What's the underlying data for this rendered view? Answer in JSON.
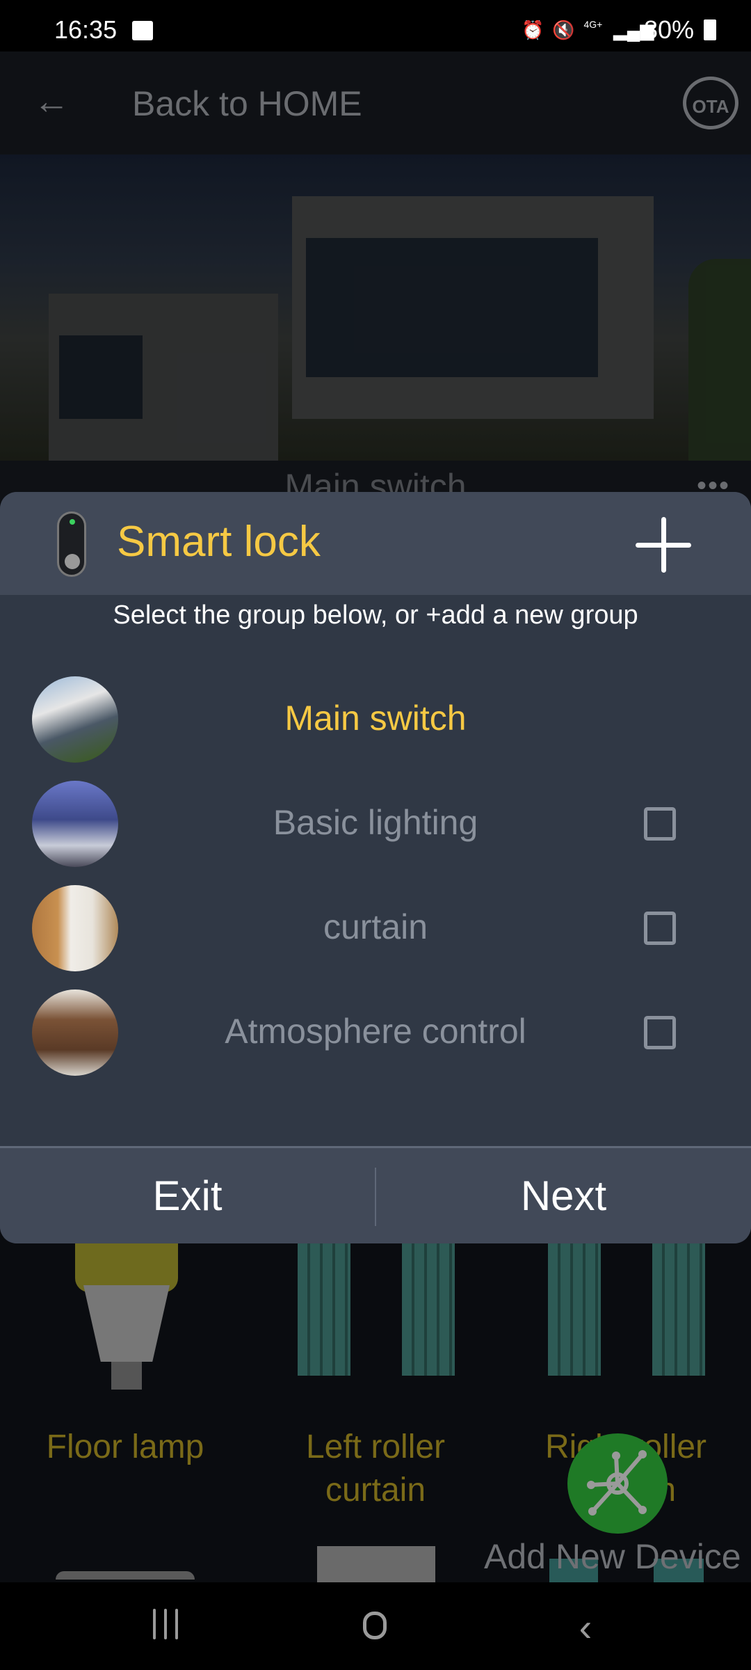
{
  "status_bar": {
    "time": "16:35",
    "network": "4G+",
    "battery": "80%",
    "icons": [
      "gallery-icon",
      "alarm-icon",
      "mute-icon",
      "data-arrows-icon",
      "signal-icon",
      "battery-charging-icon"
    ]
  },
  "app_bar": {
    "back_label": "Back to HOME",
    "ota_label": "OTA"
  },
  "background": {
    "section_title": "Main switch",
    "more_label": "•••",
    "devices": [
      {
        "name": "Floor lamp",
        "icon": "bulb-icon"
      },
      {
        "name": "Left roller curtain",
        "line1": "Left roller",
        "line2": "curtain",
        "icon": "curtain-icon"
      },
      {
        "name": "Right roller curtain",
        "line1": "Right roller",
        "line2": "curtain",
        "icon": "curtain-icon"
      }
    ],
    "fab_label": "Add New Device"
  },
  "dialog": {
    "device_name": "Smart lock",
    "add_label": "+",
    "subtitle": "Select the group below, or +add a new group",
    "groups": [
      {
        "name": "Main switch",
        "active": true,
        "checked": null
      },
      {
        "name": "Basic lighting",
        "active": false,
        "checked": false
      },
      {
        "name": "curtain",
        "active": false,
        "checked": false
      },
      {
        "name": "Atmosphere control",
        "active": false,
        "checked": false
      }
    ],
    "exit_label": "Exit",
    "next_label": "Next"
  },
  "colors": {
    "accent": "#f6c944",
    "dialog_bg": "#303845",
    "dialog_header": "#414958",
    "muted_text": "#8a919c",
    "fab": "#1f7a26"
  }
}
